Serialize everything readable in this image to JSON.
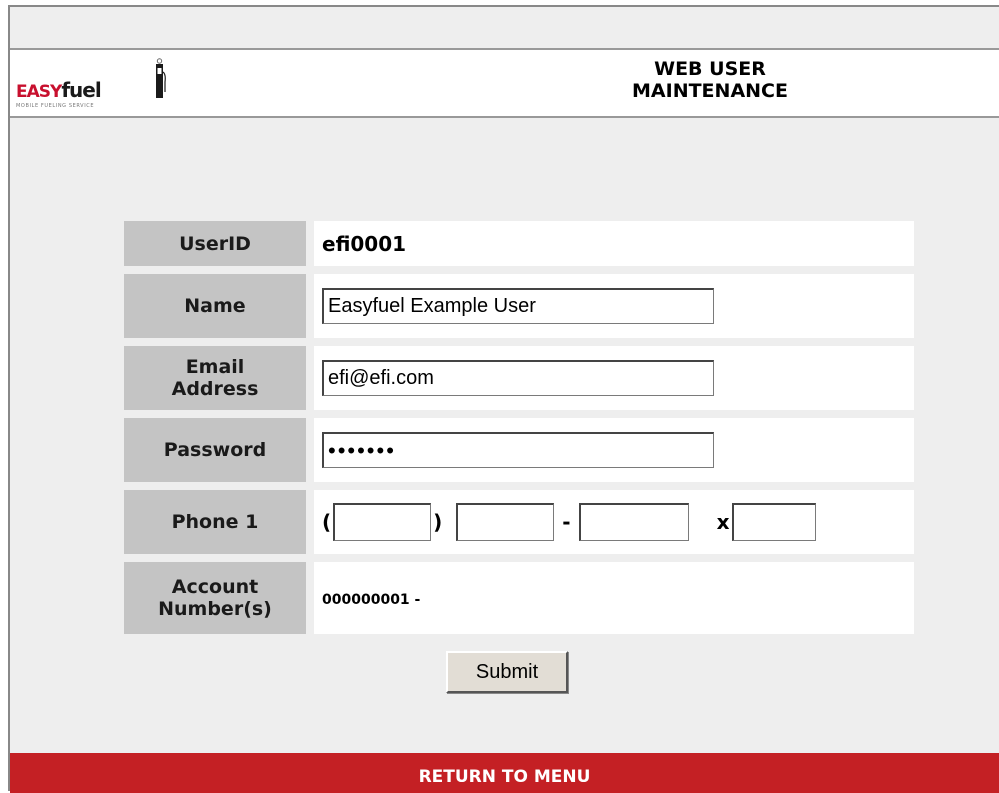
{
  "logo": {
    "brand_part1": "EASY",
    "brand_part2": "fuel",
    "tagline": "MOBILE FUELING SERVICE",
    "icon": "fuel-pump-icon",
    "colors": {
      "easy": "#c8102e",
      "fuel": "#1a1a1a"
    }
  },
  "header": {
    "title_line1": "WEB USER",
    "title_line2": "MAINTENANCE"
  },
  "form": {
    "userid": {
      "label": "UserID",
      "value": "efi0001"
    },
    "name": {
      "label": "Name",
      "value": "Easyfuel Example User"
    },
    "email": {
      "label_line1": "Email",
      "label_line2": "Address",
      "value": "efi@efi.com"
    },
    "password": {
      "label": "Password",
      "value": "1234567"
    },
    "phone": {
      "label": "Phone 1",
      "open_paren": "(",
      "close_paren": ")",
      "dash": "-",
      "ext_prefix": "x",
      "area": "",
      "prefix": "",
      "number": "",
      "extension": ""
    },
    "account": {
      "label_line1": "Account",
      "label_line2": "Number(s)",
      "value": "000000001 -"
    }
  },
  "submit_label": "Submit",
  "footer": {
    "return_label": "RETURN TO MENU",
    "bar_color": "#c42024"
  },
  "colors": {
    "background": "#eeeeee",
    "label_cell": "#c4c4c4"
  }
}
